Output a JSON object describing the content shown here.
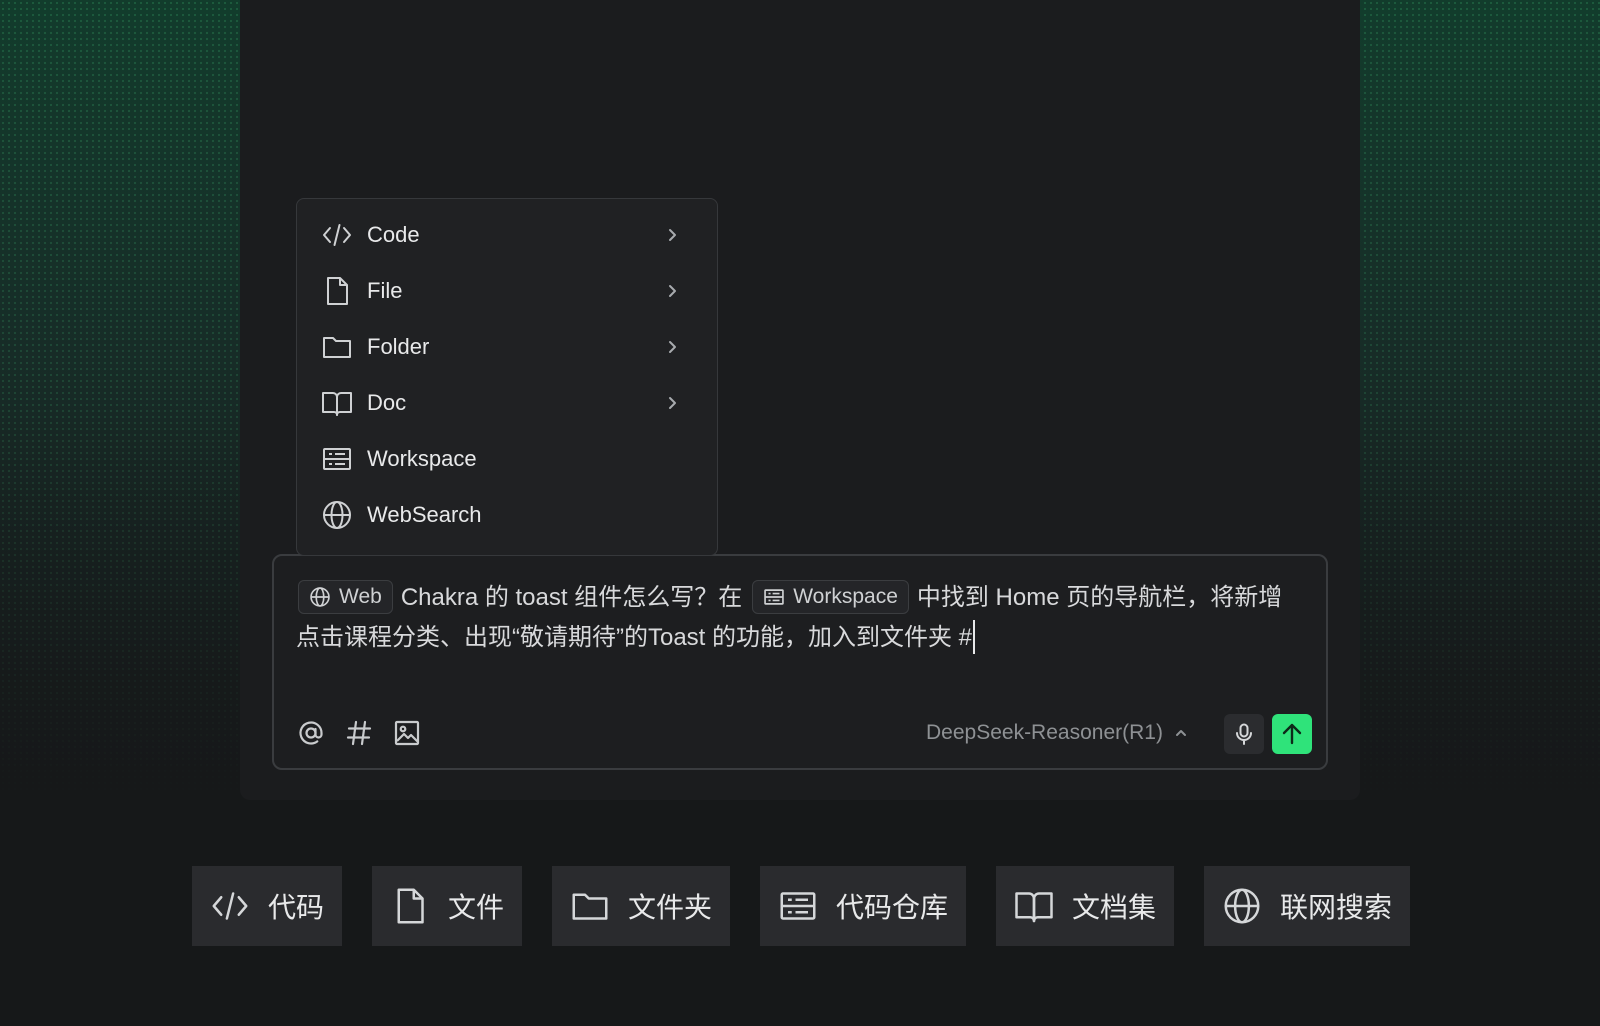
{
  "menu": {
    "items": [
      {
        "label": "Code",
        "icon": "code-icon",
        "has_submenu": true
      },
      {
        "label": "File",
        "icon": "file-icon",
        "has_submenu": true
      },
      {
        "label": "Folder",
        "icon": "folder-icon",
        "has_submenu": true
      },
      {
        "label": "Doc",
        "icon": "book-icon",
        "has_submenu": true
      },
      {
        "label": "Workspace",
        "icon": "workspace-icon",
        "has_submenu": false
      },
      {
        "label": "WebSearch",
        "icon": "globe-icon",
        "has_submenu": false
      }
    ]
  },
  "composer": {
    "chip_web": "Web",
    "text_part1": "Chakra 的 toast 组件怎么写？在",
    "chip_workspace": "Workspace",
    "text_part2": "中找到 Home 页的导航栏，将新增点击课程分类、出现“敬请期待”的Toast 的功能，加入到文件夹 #",
    "model": "DeepSeek-Reasoner(R1)",
    "send_color": "#2fe37a"
  },
  "actions": [
    {
      "label": "代码",
      "icon": "code-icon"
    },
    {
      "label": "文件",
      "icon": "file-icon"
    },
    {
      "label": "文件夹",
      "icon": "folder-icon"
    },
    {
      "label": "代码仓库",
      "icon": "workspace-icon"
    },
    {
      "label": "文档集",
      "icon": "book-icon"
    },
    {
      "label": "联网搜索",
      "icon": "globe-icon"
    }
  ]
}
